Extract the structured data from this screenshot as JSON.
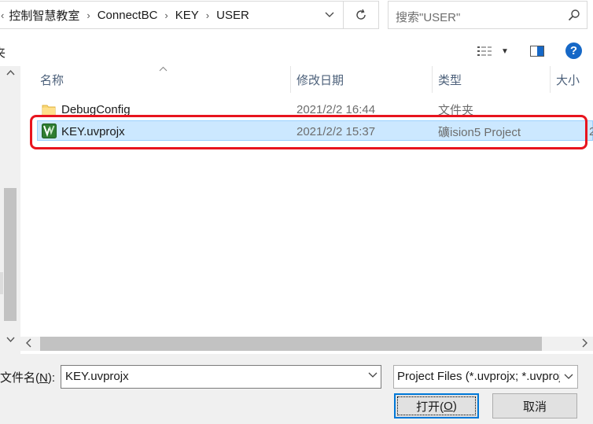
{
  "address_bar": {
    "breadcrumbs": [
      "控制智慧教室",
      "ConnectBC",
      "KEY",
      "USER"
    ]
  },
  "search": {
    "placeholder": "搜索\"USER\""
  },
  "toolbar": {
    "cut_label": "夹"
  },
  "columns": {
    "name": "名称",
    "modified": "修改日期",
    "type": "类型",
    "size": "大小"
  },
  "files": [
    {
      "name": "DebugConfig",
      "modified": "2021/2/2 16:44",
      "type": "文件夹",
      "icon": "folder-icon",
      "selected": false
    },
    {
      "name": "KEY.uvprojx",
      "modified": "2021/2/2 15:37",
      "type": "礦ision5 Project",
      "size_stub": "2",
      "icon": "uvision-icon",
      "selected": true
    }
  ],
  "footer": {
    "filename_label_pre": "文件名(",
    "filename_label_key": "N",
    "filename_label_post": "):",
    "filename_value": "KEY.uvprojx",
    "filetype_value": "Project Files (*.uvprojx;  *.uvproj)",
    "open_pre": "打开(",
    "open_key": "O",
    "open_post": ")",
    "cancel_label": "取消"
  },
  "colors": {
    "selection": "#cce8ff",
    "highlight": "#e8141e",
    "accent": "#0078d7",
    "help": "#1668c7"
  }
}
